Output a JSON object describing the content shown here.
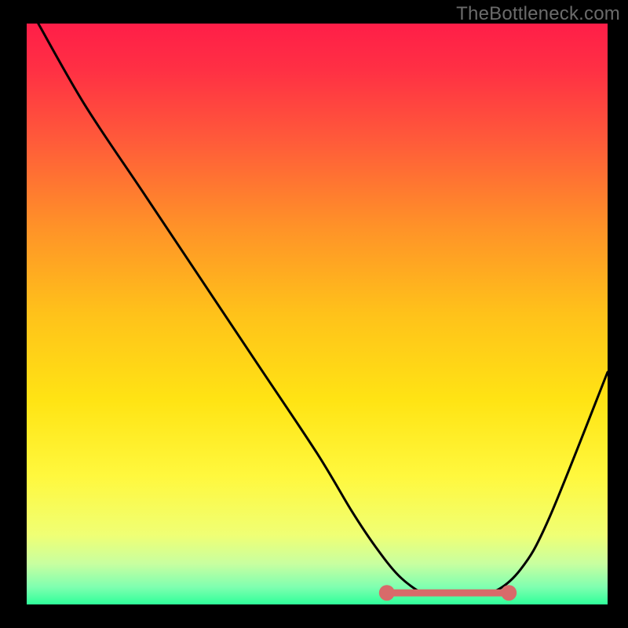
{
  "watermark": "TheBottleneck.com",
  "chart_data": {
    "type": "line",
    "title": "",
    "xlabel": "",
    "ylabel": "",
    "xlim": [
      0,
      100
    ],
    "ylim": [
      0,
      100
    ],
    "x": [
      2,
      10,
      20,
      30,
      40,
      50,
      56,
      60,
      64,
      68,
      70,
      75,
      80,
      85,
      90,
      100
    ],
    "values": [
      100,
      86,
      71,
      56,
      41,
      26,
      16,
      10,
      5,
      2,
      2,
      2,
      2,
      6,
      15,
      40
    ],
    "flat_region": {
      "x0": 62,
      "x1": 83,
      "y": 2
    },
    "background_gradient": [
      {
        "offset": 0.0,
        "color": "#ff1e48"
      },
      {
        "offset": 0.08,
        "color": "#ff3044"
      },
      {
        "offset": 0.2,
        "color": "#ff5a3a"
      },
      {
        "offset": 0.35,
        "color": "#ff9228"
      },
      {
        "offset": 0.5,
        "color": "#ffc21a"
      },
      {
        "offset": 0.65,
        "color": "#ffe414"
      },
      {
        "offset": 0.78,
        "color": "#fff83e"
      },
      {
        "offset": 0.88,
        "color": "#f0ff74"
      },
      {
        "offset": 0.93,
        "color": "#c8ffa0"
      },
      {
        "offset": 0.97,
        "color": "#7fffb0"
      },
      {
        "offset": 1.0,
        "color": "#2fff9a"
      }
    ],
    "curve_color": "#000000",
    "flat_color": "#d86a6a",
    "flat_stroke_width": 9,
    "marker_radius": 10
  }
}
